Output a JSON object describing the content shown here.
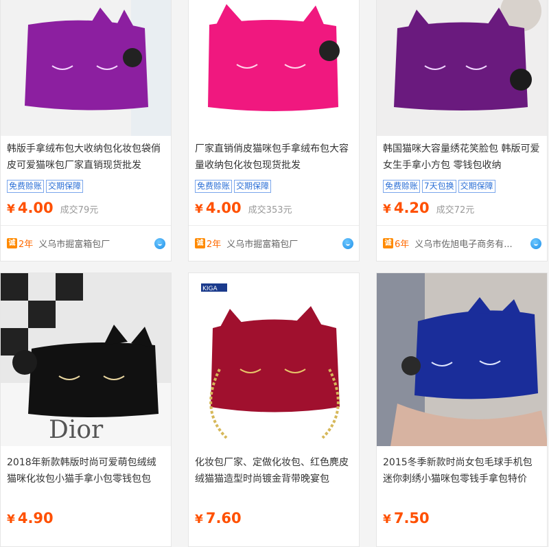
{
  "products": [
    {
      "title": "韩版手拿绒布包大收纳包化妆包袋俏皮可爱猫咪包厂家直销现货批发",
      "tags": [
        "免费赊账",
        "交期保障"
      ],
      "price_symbol": "¥",
      "price": "4.00",
      "sold": "成交79元",
      "years": "2年",
      "shop": "义乌市掘富箱包厂",
      "bag_color": "#8c1fa0"
    },
    {
      "title": "厂家直销俏皮猫咪包手拿绒布包大容量收纳包化妆包现货批发",
      "tags": [
        "免费赊账",
        "交期保障"
      ],
      "price_symbol": "¥",
      "price": "4.00",
      "sold": "成交353元",
      "years": "2年",
      "shop": "义乌市掘富箱包厂",
      "bag_color": "#f0187f"
    },
    {
      "title": "韩国猫咪大容量绣花笑脸包 韩版可爱女生手拿小方包 零钱包收纳",
      "tags": [
        "免费赊账",
        "7天包换",
        "交期保障"
      ],
      "price_symbol": "¥",
      "price": "4.20",
      "sold": "成交72元",
      "years": "6年",
      "shop": "义乌市佐旭电子商务有...",
      "bag_color": "#6a1a7e"
    },
    {
      "title": "2018年新款韩版时尚可爱萌包绒绒猫咪化妆包小猫手拿小包零钱包包",
      "price_symbol": "¥",
      "price": "4.90",
      "bag_color": "#111111",
      "image_text": "Dior"
    },
    {
      "title": "化妆包厂家、定做化妆包、红色麂皮绒猫猫造型时尚镀金背带晚宴包",
      "price_symbol": "¥",
      "price": "7.60",
      "bag_color": "#a0102e",
      "image_text": "KIGA"
    },
    {
      "title": "2015冬季新款时尚女包毛球手机包迷你刺绣小猫咪包零钱手拿包特价",
      "price_symbol": "¥",
      "price": "7.50",
      "bag_color": "#1a2d9a"
    }
  ]
}
